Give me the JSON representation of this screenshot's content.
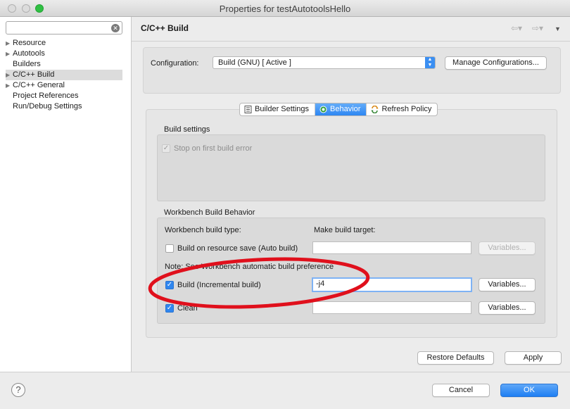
{
  "window": {
    "title": "Properties for testAutotoolsHello"
  },
  "sidebar": {
    "filter": {
      "value": "",
      "placeholder": ""
    },
    "items": [
      {
        "label": "Resource",
        "expandable": true,
        "selected": false
      },
      {
        "label": "Autotools",
        "expandable": true,
        "selected": false
      },
      {
        "label": "Builders",
        "expandable": false,
        "selected": false
      },
      {
        "label": "C/C++ Build",
        "expandable": true,
        "selected": true
      },
      {
        "label": "C/C++ General",
        "expandable": true,
        "selected": false
      },
      {
        "label": "Project References",
        "expandable": false,
        "selected": false
      },
      {
        "label": "Run/Debug Settings",
        "expandable": false,
        "selected": false
      }
    ]
  },
  "header": {
    "title": "C/C++ Build",
    "back_glyph": "⇦▾",
    "forward_glyph": "⇨▾",
    "menu_glyph": "▼"
  },
  "configuration": {
    "label": "Configuration:",
    "selected": "Build (GNU)  [ Active ]",
    "manage_button": "Manage Configurations..."
  },
  "tabs": [
    {
      "label": "Builder Settings",
      "active": false,
      "icon": "builder-settings-icon"
    },
    {
      "label": "Behavior",
      "active": true,
      "icon": "behavior-icon"
    },
    {
      "label": "Refresh Policy",
      "active": false,
      "icon": "refresh-policy-icon"
    }
  ],
  "build_settings": {
    "title": "Build settings",
    "stop_on_first_error": {
      "label": "Stop on first build error",
      "checked": true,
      "enabled": false
    }
  },
  "workbench": {
    "title": "Workbench Build Behavior",
    "type_header": "Workbench build type:",
    "target_header": "Make build target:",
    "auto_build": {
      "label": "Build on resource save (Auto build)",
      "checked": false,
      "value": "",
      "variables": "Variables..."
    },
    "note": "Note: See Workbench automatic build preference",
    "incremental": {
      "label": "Build (Incremental build)",
      "checked": true,
      "value": "-j4",
      "variables": "Variables..."
    },
    "clean": {
      "label": "Clean",
      "checked": true,
      "value": "",
      "variables": "Variables..."
    }
  },
  "buttons": {
    "restore_defaults": "Restore Defaults",
    "apply": "Apply",
    "cancel": "Cancel",
    "ok": "OK",
    "help": "?"
  },
  "colors": {
    "accent": "#2f86ef",
    "annotation": "#e0101c"
  }
}
